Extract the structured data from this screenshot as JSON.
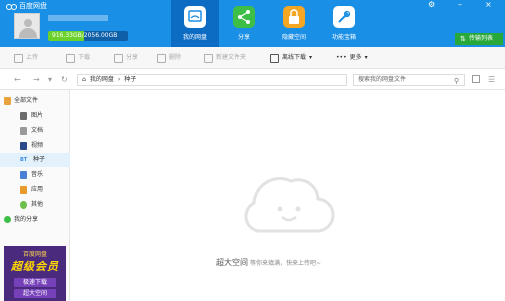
{
  "header": {
    "app_name": "百度网盘",
    "quota_text": "916.33GB/2056.00GB",
    "quota_fraction": 0.4457,
    "tabs": [
      {
        "label": "我的网盘",
        "color": "#ffffff"
      },
      {
        "label": "分享",
        "color": "#3dbf47"
      },
      {
        "label": "隐藏空间",
        "color": "#f5a623"
      },
      {
        "label": "功能宝箱",
        "color": "#ffffff"
      }
    ],
    "transfer_label": "传输列表"
  },
  "toolbar": {
    "upload": "上传",
    "download": "下载",
    "share": "分享",
    "delete": "删除",
    "new_folder": "新建文件夹",
    "offline": "离线下载",
    "more": "更多"
  },
  "address": {
    "root": "我的网盘",
    "current": "种子",
    "search_placeholder": "搜索我的网盘文件"
  },
  "sidebar": {
    "items": [
      {
        "label": "全部文件",
        "color": "#e8a33d"
      },
      {
        "label": "图片",
        "color": "#6b6b6b"
      },
      {
        "label": "文档",
        "color": "#9a9a9a"
      },
      {
        "label": "视频",
        "color": "#2b4a8c"
      },
      {
        "label": "种子",
        "color": "#3a8ee6",
        "icon_text": "BT"
      },
      {
        "label": "音乐",
        "color": "#4a7fd6"
      },
      {
        "label": "应用",
        "color": "#e89a2b"
      },
      {
        "label": "其他",
        "color": "#6cc04a"
      },
      {
        "label": "我的分享",
        "color": "#3dbf47"
      }
    ]
  },
  "promo": {
    "top": "百度网盘",
    "big": "超级会员",
    "line1": "极速下载",
    "line2": "超大空间"
  },
  "empty_state": {
    "title": "超大空间",
    "subtitle": "等你来填满，快来上传吧~"
  }
}
